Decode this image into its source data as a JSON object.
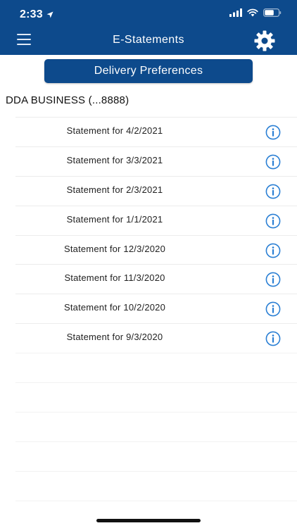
{
  "status_bar": {
    "time": "2:33"
  },
  "nav": {
    "title": "E-Statements"
  },
  "delivery_button": {
    "label": "Delivery Preferences"
  },
  "account": {
    "name": "DDA BUSINESS  (...8888)"
  },
  "statements": [
    {
      "label": "Statement for 4/2/2021"
    },
    {
      "label": "Statement for 3/3/2021"
    },
    {
      "label": "Statement for 2/3/2021"
    },
    {
      "label": "Statement for 1/1/2021"
    },
    {
      "label": "Statement for 12/3/2020"
    },
    {
      "label": "Statement for 11/3/2020"
    },
    {
      "label": "Statement for 10/2/2020"
    },
    {
      "label": "Statement for 9/3/2020"
    }
  ],
  "colors": {
    "brand": "#0d4a8c",
    "info_icon": "#2a7fd4"
  },
  "icons": [
    "location-arrow-icon",
    "cellular-signal-icon",
    "wifi-icon",
    "battery-icon",
    "hamburger-menu-icon",
    "gear-icon",
    "info-icon"
  ]
}
